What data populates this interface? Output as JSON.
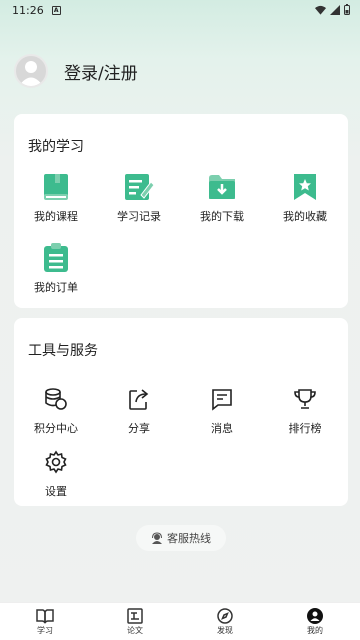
{
  "status": {
    "time": "11:26",
    "notif": "A"
  },
  "user": {
    "login_label": "登录/注册"
  },
  "study": {
    "title": "我的学习",
    "items": [
      {
        "label": "我的课程",
        "icon": "book-icon"
      },
      {
        "label": "学习记录",
        "icon": "edit-note-icon"
      },
      {
        "label": "我的下载",
        "icon": "download-folder-icon"
      },
      {
        "label": "我的收藏",
        "icon": "bookmark-star-icon"
      },
      {
        "label": "我的订单",
        "icon": "order-clipboard-icon"
      }
    ]
  },
  "tools": {
    "title": "工具与服务",
    "items": [
      {
        "label": "积分中心",
        "icon": "coins-icon"
      },
      {
        "label": "分享",
        "icon": "share-icon"
      },
      {
        "label": "消息",
        "icon": "message-icon"
      },
      {
        "label": "排行榜",
        "icon": "trophy-icon"
      },
      {
        "label": "设置",
        "icon": "gear-icon"
      }
    ]
  },
  "hotline": {
    "label": "客服热线"
  },
  "tabbar": [
    {
      "label": "学习"
    },
    {
      "label": "论文"
    },
    {
      "label": "发现"
    },
    {
      "label": "我的"
    }
  ],
  "colors": {
    "accent": "#3dbb8e",
    "accent_light": "#7ccfae"
  }
}
